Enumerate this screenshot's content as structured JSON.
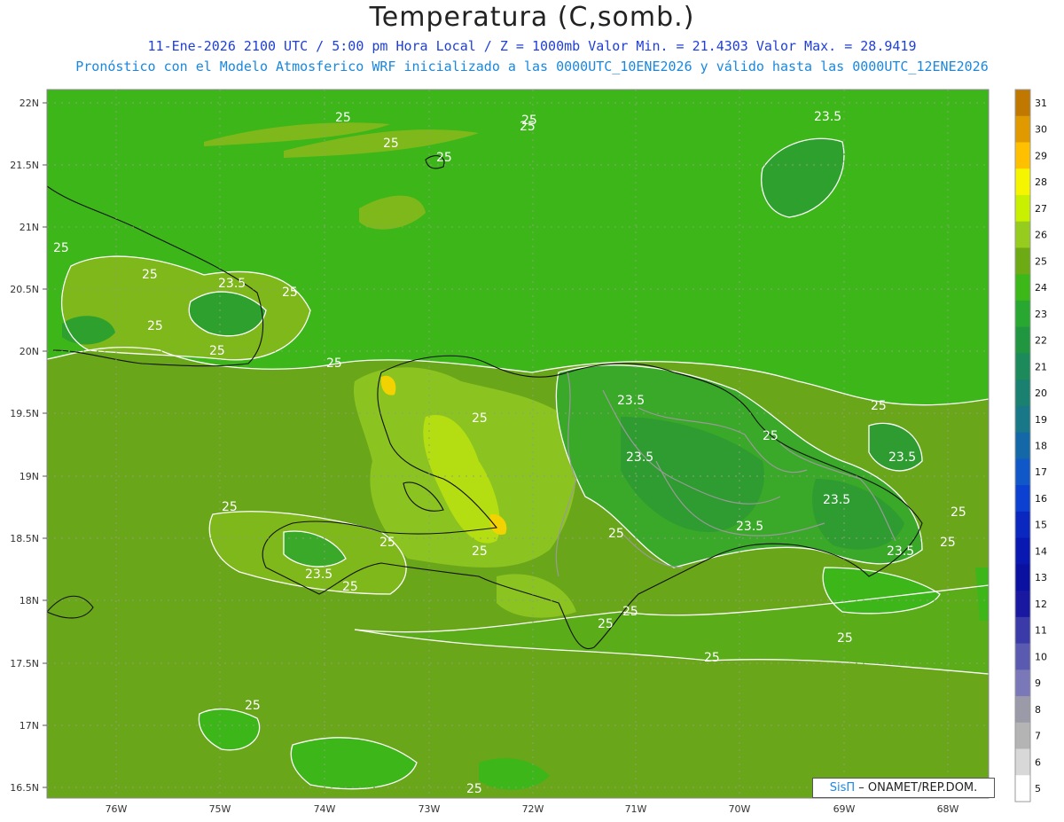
{
  "title": "Temperatura (C,somb.)",
  "subtitle1": "11-Ene-2026  2100 UTC / 5:00 pm Hora Local / Z = 1000mb    Valor Min. = 21.4303  Valor Max. = 28.9419",
  "subtitle2": "Pronóstico con el Modelo Atmosferico WRF inicializado a las 0000UTC_10ENE2026 y válido hasta las  0000UTC_12ENE2026",
  "credit": {
    "logo": "SisΠ",
    "text": " – ONAMET/REP.DOM."
  },
  "lat_labels": [
    "22N",
    "21.5N",
    "21N",
    "20.5N",
    "20N",
    "19.5N",
    "19N",
    "18.5N",
    "18N",
    "17.5N",
    "17N",
    "16.5N"
  ],
  "lon_labels": [
    "76W",
    "75W",
    "74W",
    "73W",
    "72W",
    "71W",
    "70W",
    "69W",
    "68W"
  ],
  "contour_labels": [
    "25",
    "25",
    "25",
    "25",
    "25",
    "25",
    "25",
    "23.5",
    "25",
    "25",
    "25",
    "25",
    "25",
    "25",
    "23.5",
    "23.5",
    "25",
    "25",
    "23.5",
    "25",
    "23.5",
    "25",
    "25",
    "23.5",
    "25",
    "23.5",
    "25",
    "25",
    "23.5",
    "25",
    "25",
    "25",
    "25",
    "25",
    "25",
    "25"
  ],
  "colorbar": {
    "levels": [
      "31",
      "30",
      "29",
      "28",
      "27",
      "26",
      "25",
      "24",
      "23",
      "22",
      "21",
      "20",
      "19",
      "18",
      "17",
      "16",
      "15",
      "14",
      "13",
      "12",
      "11",
      "10",
      "9",
      "8",
      "7",
      "6",
      "5"
    ],
    "colors": [
      "#c07800",
      "#e09a00",
      "#ffc000",
      "#f5f500",
      "#c8f000",
      "#96cc1e",
      "#6eaa14",
      "#3cb818",
      "#28a830",
      "#209640",
      "#1c8a5a",
      "#1a8070",
      "#187888",
      "#1468a8",
      "#1058c8",
      "#0c40d0",
      "#0a28c0",
      "#0818b0",
      "#0a10a0",
      "#1818a0",
      "#3a3aa8",
      "#5a5ab0",
      "#7a78b8",
      "#9a9aa8",
      "#b4b4b4",
      "#d8d8d8",
      "#ffffff"
    ]
  },
  "legend_colors": {
    "background": "#6aa61a",
    "ocean_warm": "#3db61a",
    "cool": "#2ea02e",
    "warm_land": "#a2cc1e",
    "hot": "#ccee10",
    "hotspot": "#f2d200"
  }
}
